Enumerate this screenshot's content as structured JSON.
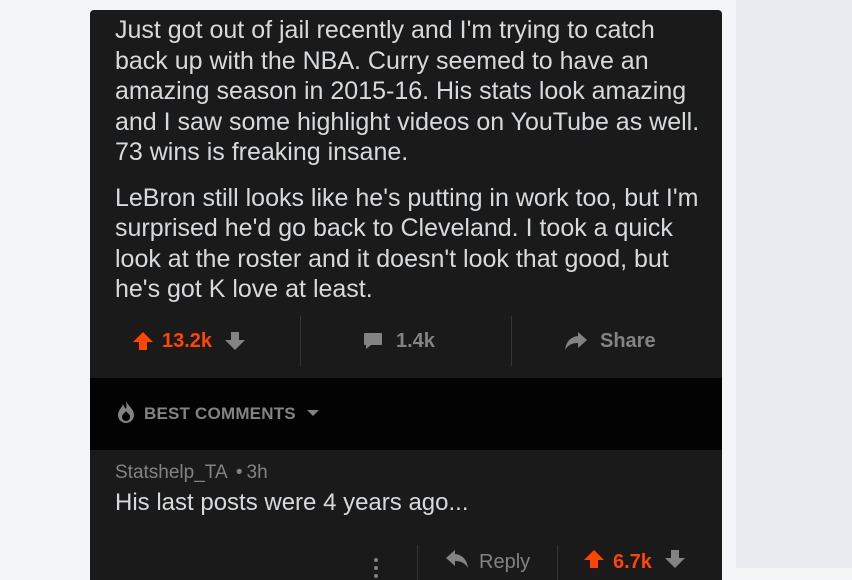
{
  "post": {
    "paragraphs": [
      "Just got out of jail recently and I'm trying to catch back up with the NBA. Curry seemed to have an amazing season in 2015-16. His stats look amazing and I saw some highlight videos on YouTube as well. 73 wins is freaking insane.",
      "LeBron still looks like he's putting in work too, but I'm surprised he'd go back to Cleveland. I took a quick look at the roster and it doesn't look that good, but he's got K love at least."
    ],
    "upvotes": "13.2k",
    "comments_count": "1.4k",
    "share_label": "Share"
  },
  "sort": {
    "label": "BEST COMMENTS"
  },
  "comment": {
    "author": "Statshelp_TA",
    "separator": "•",
    "age": "3h",
    "text": "His last posts were 4 years ago...",
    "reply_label": "Reply",
    "upvotes": "6.7k"
  },
  "colors": {
    "accent": "#ff4500",
    "muted": "#818384",
    "text": "#d7dadc",
    "card": "#1a1a1b",
    "sort_bg": "#030303"
  },
  "icons": {
    "upvote": "arrow-up-icon",
    "downvote": "arrow-down-icon",
    "comments": "comment-bubble-icon",
    "share": "share-arrow-icon",
    "sort": "flame-icon",
    "caret": "caret-down-icon",
    "reply": "reply-arrow-icon",
    "more": "more-dots-icon"
  }
}
